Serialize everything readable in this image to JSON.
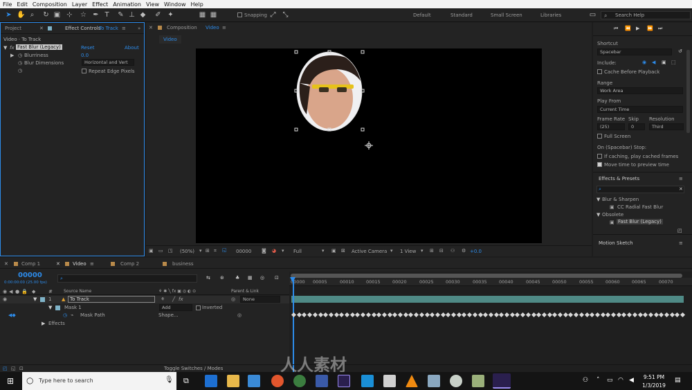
{
  "menu": [
    "File",
    "Edit",
    "Composition",
    "Layer",
    "Effect",
    "Animation",
    "View",
    "Window",
    "Help"
  ],
  "toolbar": {
    "snapping": "Snapping",
    "workspaces": [
      "Default",
      "Standard",
      "Small Screen",
      "Libraries"
    ],
    "search_placeholder": "Search Help"
  },
  "project_panel": {
    "tab_project": "Project",
    "tab_effect_controls": "Effect Controls",
    "ec_layer": "To Track",
    "breadcrumb": "Video · To Track"
  },
  "effect": {
    "name": "Fast Blur (Legacy)",
    "reset": "Reset",
    "about": "About",
    "blurriness_label": "Blurriness",
    "blurriness_value": "0.0",
    "dimensions_label": "Blur Dimensions",
    "dimensions_value": "Horizontal and Vert",
    "repeat_label": "Repeat Edge Pixels"
  },
  "composition": {
    "tab_prefix": "Composition",
    "tab_name": "Video",
    "subtab": "Video",
    "zoom": "(50%)",
    "timecode": "00000",
    "resolution": "Full",
    "camera": "Active Camera",
    "views": "1 View",
    "exposure": "+0.0"
  },
  "preview": {
    "shortcut_label": "Shortcut",
    "shortcut_value": "Spacebar",
    "include_label": "Include:",
    "cache_label": "Cache Before Playback",
    "range_label": "Range",
    "range_value": "Work Area",
    "play_from_label": "Play From",
    "play_from_value": "Current Time",
    "frame_rate_label": "Frame Rate",
    "skip_label": "Skip",
    "resolution_label": "Resolution",
    "frame_rate_value": "(25)",
    "skip_value": "0",
    "resolution_value": "Third",
    "full_screen_label": "Full Screen",
    "on_stop_label": "On (Spacebar) Stop:",
    "if_caching_label": "If caching, play cached frames",
    "move_time_label": "Move time to preview time"
  },
  "effects_presets": {
    "title": "Effects & Presets",
    "group1": "Blur & Sharpen",
    "item1": "CC Radial Fast Blur",
    "group2": "Obsolete",
    "item2": "Fast Blur (Legacy)"
  },
  "motion_sketch": {
    "title": "Motion Sketch"
  },
  "timeline_tabs": [
    "Comp 1",
    "Video",
    "Comp 2",
    "business"
  ],
  "timeline": {
    "timecode": "00000",
    "fps": "0:00:00:00 (25.00 fps)",
    "col_source": "Source Name",
    "col_parent": "Parent & Link",
    "layer_num": "1",
    "layer_name": "To Track",
    "parent_value": "None",
    "mask_name": "Mask 1",
    "mask_mode": "Add",
    "mask_inverted": "Inverted",
    "mask_path_label": "Mask Path",
    "mask_path_value": "Shape...",
    "effects_label": "Effects",
    "toggle_label": "Toggle Switches / Modes"
  },
  "ruler_ticks": [
    "00000",
    "00005",
    "00010",
    "00015",
    "00020",
    "00025",
    "00030",
    "00035",
    "00040",
    "00045",
    "00050",
    "00055",
    "00060",
    "00065",
    "00070"
  ],
  "watermark": "人人素材",
  "taskbar": {
    "search_placeholder": "Type here to search",
    "time": "9:51 PM",
    "date": "1/3/2019"
  }
}
